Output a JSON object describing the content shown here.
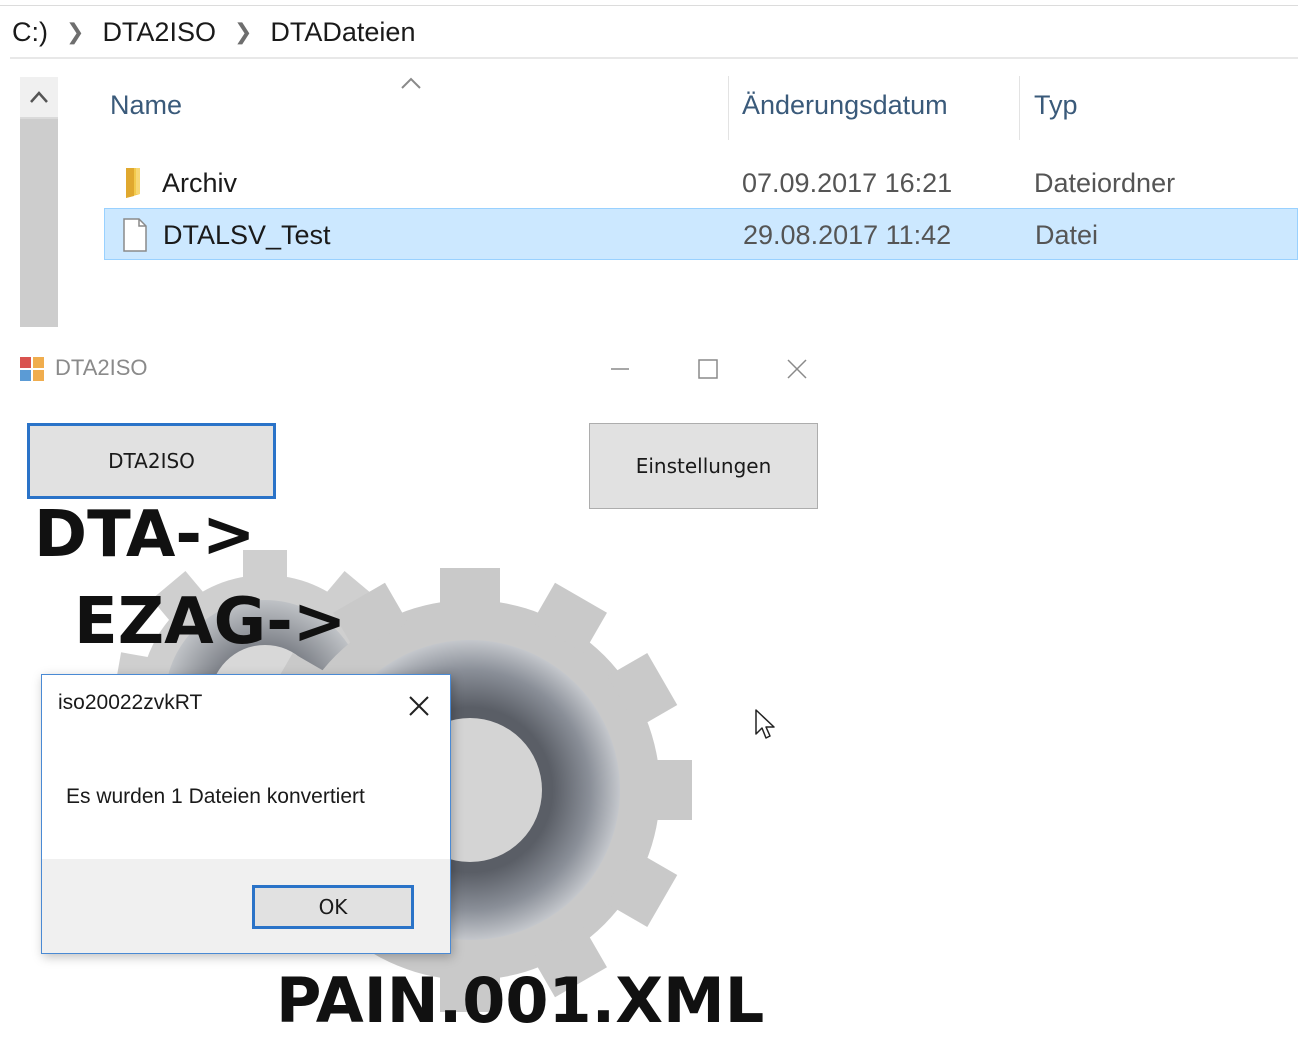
{
  "explorer": {
    "breadcrumb": [
      "C:)",
      "DTA2ISO",
      "DTADateien"
    ],
    "columns": {
      "name": "Name",
      "date": "Änderungsdatum",
      "type": "Typ"
    },
    "files": [
      {
        "name": "Archiv",
        "date": "07.09.2017 16:21",
        "type": "Dateiordner",
        "icon": "folder-icon",
        "selected": false
      },
      {
        "name": "DTALSV_Test",
        "date": "29.08.2017 11:42",
        "type": "Datei",
        "icon": "file-icon",
        "selected": true
      }
    ]
  },
  "app": {
    "title": "DTA2ISO",
    "convert_button": "DTA2ISO",
    "settings_button": "Einstellungen",
    "logo_text_1": "DTA->",
    "logo_text_2": "EZAG->",
    "logo_text_3": "PAIN.001.XML"
  },
  "message_box": {
    "title": "iso20022zvkRT",
    "text": "Es wurden 1 Dateien konvertiert",
    "ok_label": "OK"
  },
  "colors": {
    "selection": "#cce8ff",
    "focus_border": "#2a73c8",
    "header_text": "#3a5a7a"
  }
}
